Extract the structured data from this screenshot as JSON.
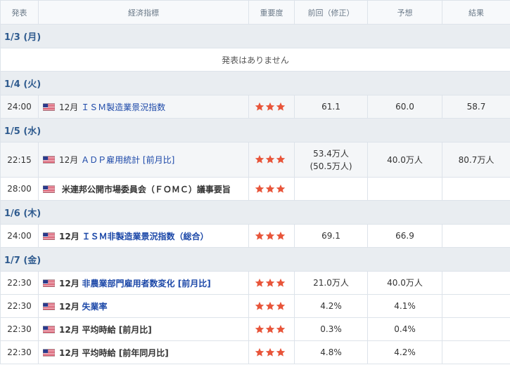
{
  "headers": {
    "date": "発表",
    "indicator": "経済指標",
    "importance": "重要度",
    "previous": "前回（修正）",
    "forecast": "予想",
    "result": "結果"
  },
  "days": {
    "d1": {
      "label": "1/3 (月)",
      "no_events": "発表はありません"
    },
    "d2": {
      "label": "1/4 (火)"
    },
    "d3": {
      "label": "1/5 (水)"
    },
    "d4": {
      "label": "1/6 (木)"
    },
    "d5": {
      "label": "1/7 (金)"
    }
  },
  "events": {
    "e1": {
      "time": "24:00",
      "month": "12月",
      "name": "ＩＳＭ製造業景況指数",
      "previous": "61.1",
      "forecast": "60.0",
      "result": "58.7"
    },
    "e2": {
      "time": "22:15",
      "month": "12月",
      "name": "ＡＤＰ雇用統計 [前月比]",
      "previous": "53.4万人",
      "previous_revised": "(50.5万人)",
      "forecast": "40.0万人",
      "result": "80.7万人"
    },
    "e3": {
      "time": "28:00",
      "month": "",
      "name": "米連邦公開市場委員会（ＦＯＭＣ）議事要旨",
      "previous": "",
      "forecast": "",
      "result": ""
    },
    "e4": {
      "time": "24:00",
      "month": "12月",
      "name": "ＩＳＭ非製造業景況指数（総合）",
      "previous": "69.1",
      "forecast": "66.9",
      "result": ""
    },
    "e5": {
      "time": "22:30",
      "month": "12月",
      "name": "非農業部門雇用者数変化 [前月比]",
      "previous": "21.0万人",
      "forecast": "40.0万人",
      "result": ""
    },
    "e6": {
      "time": "22:30",
      "month": "12月",
      "name": "失業率",
      "previous": "4.2%",
      "forecast": "4.1%",
      "result": ""
    },
    "e7": {
      "time": "22:30",
      "month": "12月",
      "name": "平均時給 [前月比]",
      "previous": "0.3%",
      "forecast": "0.4%",
      "result": ""
    },
    "e8": {
      "time": "22:30",
      "month": "12月",
      "name": "平均時給 [前年同月比]",
      "previous": "4.8%",
      "forecast": "4.2%",
      "result": ""
    }
  },
  "icons": {
    "flag": "us-flag-icon",
    "importance": "star-icon"
  },
  "importance_stars": 3,
  "colors": {
    "star": "#e8553a",
    "link": "#1c48a8",
    "date_text": "#2f5b8f",
    "date_bg": "#e9edf1"
  }
}
